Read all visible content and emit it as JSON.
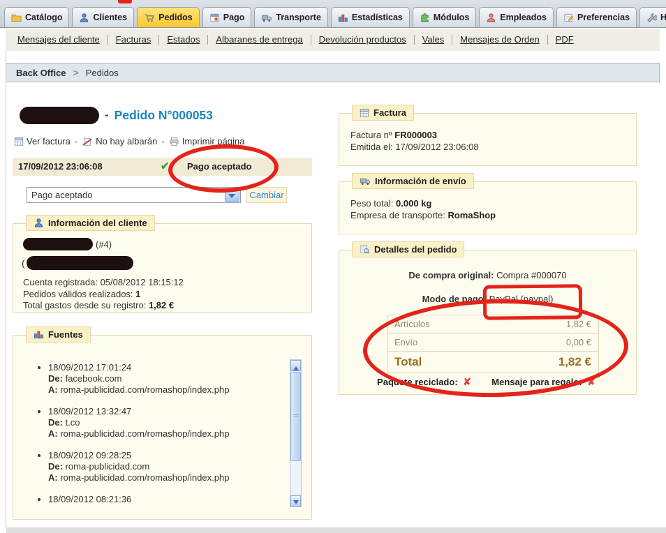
{
  "colors": {
    "annotation_red": "#e3241b",
    "tab_active": "#fec72d",
    "link_blue": "#2389ce",
    "title_blue": "#1a85be",
    "panel_bg": "#fdfcee",
    "panel_border": "#e2d9a8",
    "status_bg": "#f1ead4",
    "total_brown": "#9c6e1e",
    "row_tan": "#9a8b64",
    "check_green": "#3ba03b",
    "cross_red": "#e24040"
  },
  "tabs": [
    {
      "label": "Catálogo",
      "icon": "folder-icon"
    },
    {
      "label": "Clientes",
      "icon": "customers-icon"
    },
    {
      "label": "Pedidos",
      "icon": "cart-icon"
    },
    {
      "label": "Pago",
      "icon": "payment-icon"
    },
    {
      "label": "Transporte",
      "icon": "truck-icon"
    },
    {
      "label": "Estadísticas",
      "icon": "stats-icon"
    },
    {
      "label": "Módulos",
      "icon": "puzzle-icon"
    },
    {
      "label": "Empleados",
      "icon": "employee-icon"
    },
    {
      "label": "Preferencias",
      "icon": "notepad-icon"
    },
    {
      "label": "Herramientas",
      "icon": "wrench-icon"
    }
  ],
  "submenu": [
    "Mensajes del cliente",
    "Facturas",
    "Estados",
    "Albaranes de entrega",
    "Devolución productos",
    "Vales",
    "Mensajes de Orden",
    "PDF"
  ],
  "breadcrumb": {
    "root": "Back Office",
    "separator": ">",
    "current": "Pedidos"
  },
  "order": {
    "dash": "-",
    "number_title": "Pedido N°000053",
    "actions": [
      "Ver factura",
      "No hay albarán",
      "Imprimir página"
    ],
    "action_separator": "-",
    "status_date": "17/09/2012 23:06:08",
    "status_check": "✔",
    "status_label": "Pago aceptado",
    "select_value": "Pago aceptado",
    "change_button": "Cambiar"
  },
  "customer": {
    "title": "Información del cliente",
    "id_note": "(#4)",
    "paren": "(",
    "registered_label": "Cuenta registrada:",
    "registered_value": "05/08/2012 18:15:12",
    "orders_label": "Pedidos válidos realizados:",
    "orders_value": "1",
    "spent_label": "Total gastos desde su registro:",
    "spent_value": "1,82 €"
  },
  "sources": {
    "title": "Fuentes",
    "from_label": "De:",
    "to_label": "A:",
    "items": [
      {
        "date": "18/09/2012 17:01:24",
        "from": "facebook.com",
        "to": "roma-publicidad.com/romashop/index.php"
      },
      {
        "date": "18/09/2012 13:32:47",
        "from": "t.co",
        "to": "roma-publicidad.com/romashop/index.php"
      },
      {
        "date": "18/09/2012 09:28:25",
        "from": "roma-publicidad.com",
        "to": "roma-publicidad.com/romashop/index.php"
      },
      {
        "date": "18/09/2012 08:21:36",
        "from": "",
        "to": ""
      }
    ]
  },
  "invoice": {
    "title": "Factura",
    "number_label": "Factura nº ",
    "number": "FR000003",
    "issued_label": "Emitida el: ",
    "issued_value": "17/09/2012 23:06:08"
  },
  "shipping": {
    "title": "Información de envío",
    "weight_label": "Peso total: ",
    "weight_value": "0.000 kg",
    "carrier_label": "Empresa de transporte: ",
    "carrier_value": "RomaShop"
  },
  "details": {
    "title": "Detalles del pedido",
    "original_label": "De compra original: ",
    "original_value": "Compra #000070",
    "payment_label": "Modo de pago: ",
    "payment_value": "PayPal (paypal)",
    "totals": [
      {
        "label": "Artículos",
        "value": "1,82 €"
      },
      {
        "label": "Envío",
        "value": "0,00 €"
      },
      {
        "label": "Total",
        "value": "1,82 €"
      }
    ],
    "recycled_label": "Paquete reciclado:",
    "gift_label": "Mensaje para regalo:",
    "cross": "✘"
  }
}
